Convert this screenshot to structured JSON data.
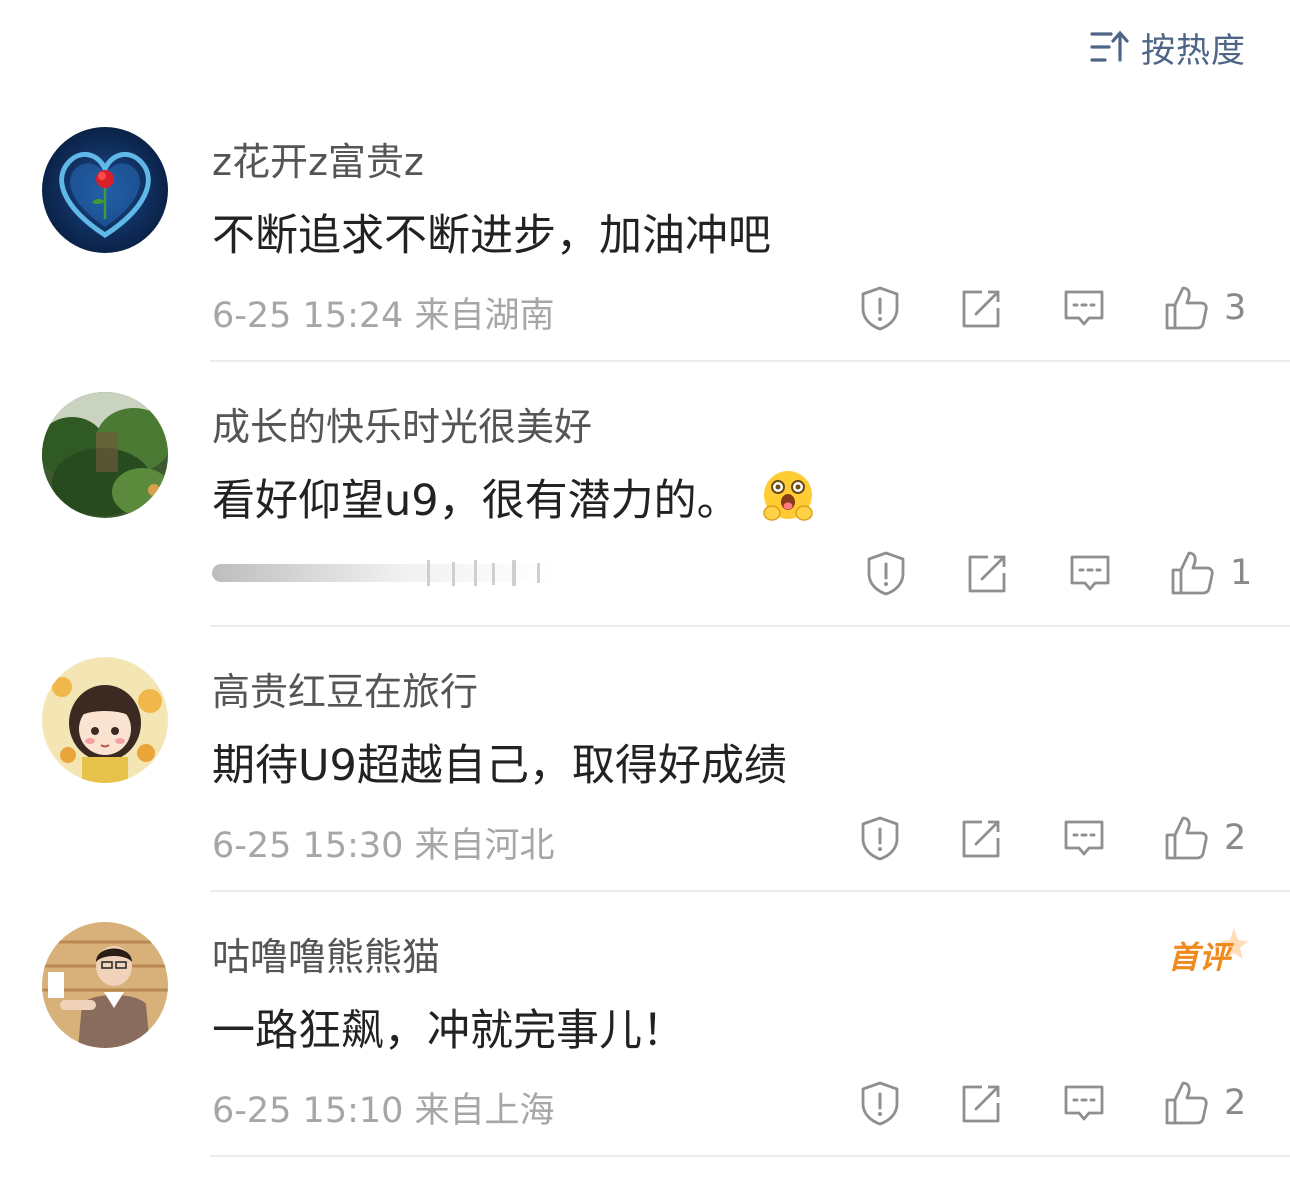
{
  "sort": {
    "label": "按热度"
  },
  "comments": [
    {
      "username": "z花开z富贵z",
      "text": "不断追求不断进步，加油冲吧",
      "meta": "6-25 15:24  来自湖南",
      "likes": "3",
      "avatar": "rose-heart-avatar"
    },
    {
      "username": "成长的快乐时光很美好",
      "text": "看好仰望u9，很有潜力的。",
      "meta": "",
      "likes": "1",
      "avatar": "jungle-avatar",
      "emoji": "smiling-face-with-open-hands-emoji"
    },
    {
      "username": "高贵红豆在旅行",
      "text": "期待U9超越自己，取得好成绩",
      "meta": "6-25 15:30  来自河北",
      "likes": "2",
      "avatar": "cartoon-girl-avatar"
    },
    {
      "username": "咕噜噜熊熊猫",
      "text": "一路狂飙，冲就完事儿！",
      "meta": "6-25 15:10  来自上海",
      "likes": "2",
      "avatar": "boy-photo-avatar",
      "badge": "首评"
    }
  ],
  "icons": {
    "sort": "sort-icon",
    "report": "report-icon",
    "repost": "repost-icon",
    "reply": "reply-icon",
    "like": "like-icon"
  },
  "colors": {
    "sort_accent": "#4f6586",
    "meta_gray": "#a6a6a6",
    "badge_orange": "#f08a1c"
  }
}
